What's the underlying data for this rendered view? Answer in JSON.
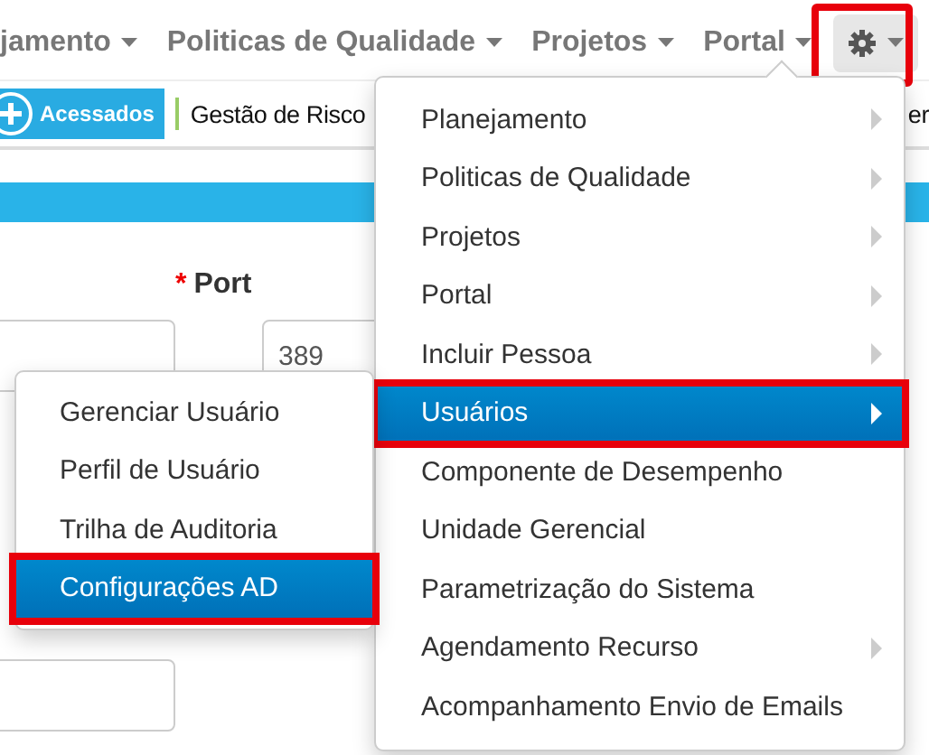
{
  "nav": {
    "items": [
      {
        "label": "jamento"
      },
      {
        "label": "Politicas de Qualidade"
      },
      {
        "label": "Projetos"
      },
      {
        "label": "Portal"
      }
    ],
    "settings_highlighted": true
  },
  "quick_bar": {
    "badge": "Acessados",
    "links": [
      "Gestão de Risco",
      "er"
    ]
  },
  "form": {
    "port_label": "Port",
    "port_required": true,
    "required_mark": "*",
    "port_value": "389"
  },
  "menu": [
    {
      "label": "Planejamento",
      "has_submenu": true,
      "selected": false
    },
    {
      "label": "Politicas de Qualidade",
      "has_submenu": true,
      "selected": false
    },
    {
      "label": "Projetos",
      "has_submenu": true,
      "selected": false
    },
    {
      "label": "Portal",
      "has_submenu": true,
      "selected": false
    },
    {
      "label": "Incluir Pessoa",
      "has_submenu": true,
      "selected": false
    },
    {
      "label": "Usuários",
      "has_submenu": true,
      "selected": true
    },
    {
      "label": "Componente de Desempenho",
      "has_submenu": false,
      "selected": false
    },
    {
      "label": "Unidade Gerencial",
      "has_submenu": false,
      "selected": false
    },
    {
      "label": "Parametrização do Sistema",
      "has_submenu": false,
      "selected": false
    },
    {
      "label": "Agendamento Recurso",
      "has_submenu": true,
      "selected": false
    },
    {
      "label": "Acompanhamento Envio de Emails",
      "has_submenu": false,
      "selected": false
    }
  ],
  "submenu": [
    {
      "label": "Gerenciar Usuário",
      "selected": false
    },
    {
      "label": "Perfil de Usuário",
      "selected": false
    },
    {
      "label": "Trilha de Auditoria",
      "selected": false
    },
    {
      "label": "Configurações AD",
      "selected": true
    }
  ]
}
